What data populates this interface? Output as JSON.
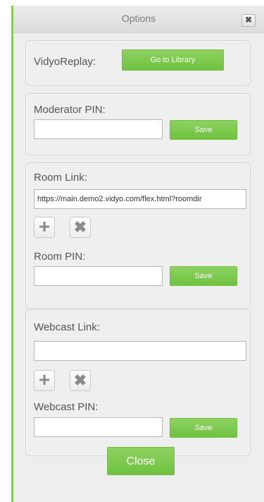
{
  "window": {
    "title": "Options",
    "close_glyph": "✖"
  },
  "vidyo_replay": {
    "label": "VidyoReplay:",
    "button": "Go to Library"
  },
  "moderator": {
    "label": "Moderator PIN:",
    "pin_value": "",
    "save": "Save"
  },
  "room": {
    "link_label": "Room Link:",
    "link_value": "https://main.demo2.vidyo.com/flex.html?roomdir",
    "add_icon": "plus-icon",
    "remove_icon": "x-icon",
    "pin_label": "Room PIN:",
    "pin_value": "",
    "save": "Save"
  },
  "webcast": {
    "link_label": "Webcast Link:",
    "link_value": "",
    "add_icon": "plus-icon",
    "remove_icon": "x-icon",
    "pin_label": "Webcast PIN:",
    "pin_value": "",
    "save": "Save"
  },
  "footer": {
    "close": "Close"
  },
  "colors": {
    "accent": "#7ac74f",
    "panel_bg": "#efefef",
    "frame_accent": "#88c95a"
  }
}
